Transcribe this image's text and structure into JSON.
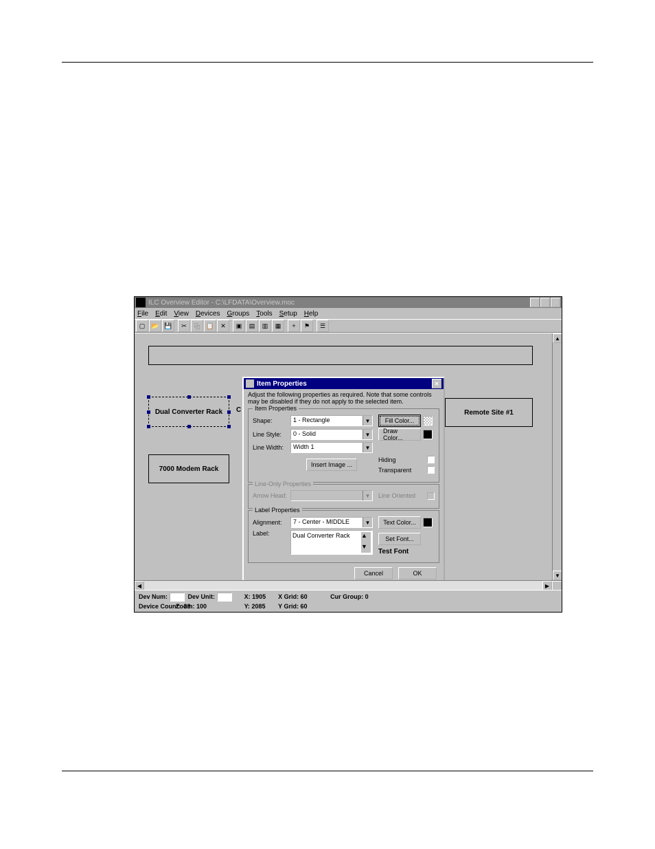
{
  "window": {
    "title": "ILC Overview Editor - C:\\LFDATA\\Overview.moc"
  },
  "menu": {
    "file": "File",
    "edit": "Edit",
    "view": "View",
    "devices": "Devices",
    "groups": "Groups",
    "tools": "Tools",
    "setup": "Setup",
    "help": "Help"
  },
  "canvas": {
    "box_dual": "Dual Converter Rack",
    "box_modem": "7000 Modem Rack",
    "box_remote": "Remote Site #1",
    "partial_c": "C"
  },
  "dialog": {
    "title": "Item Properties",
    "note": "Adjust the following properties as required.  Note that some controls may be disabled if they do not apply to the selected item.",
    "group_item": "Item Properties",
    "shape_label": "Shape:",
    "shape_value": "1 - Rectangle",
    "linestyle_label": "Line Style:",
    "linestyle_value": "0 - Solid",
    "linewidth_label": "Line Width:",
    "linewidth_value": "Width 1",
    "insert_image": "Insert Image ...",
    "fill_color": "Fill Color...",
    "draw_color": "Draw Color...",
    "hiding": "Hiding",
    "transparent": "Transparent",
    "group_line": "Line-Only Properties",
    "arrowhead_label": "Arrow Head:",
    "line_oriented": "Line Oriented",
    "group_label": "Label Properties",
    "alignment_label": "Alignment:",
    "alignment_value": "7 - Center - MIDDLE",
    "label_label": "Label:",
    "label_value": "Dual Converter Rack",
    "text_color": "Text Color...",
    "set_font": "Set Font...",
    "test_font": "Test Font",
    "cancel": "Cancel",
    "ok": "OK"
  },
  "status": {
    "dev_num": "Dev Num:",
    "dev_unit": "Dev Unit:",
    "device_count_label": "Device Count:",
    "device_count": "28",
    "x_label": "X:",
    "x": "1905",
    "y_label": "Y:",
    "y": "2085",
    "xgrid_label": "X Grid:",
    "xgrid": "60",
    "ygrid_label": "Y Grid:",
    "ygrid": "60",
    "zoom_label": "Zoom:",
    "zoom": "100",
    "curgroup_label": "Cur Group:",
    "curgroup": "0"
  }
}
